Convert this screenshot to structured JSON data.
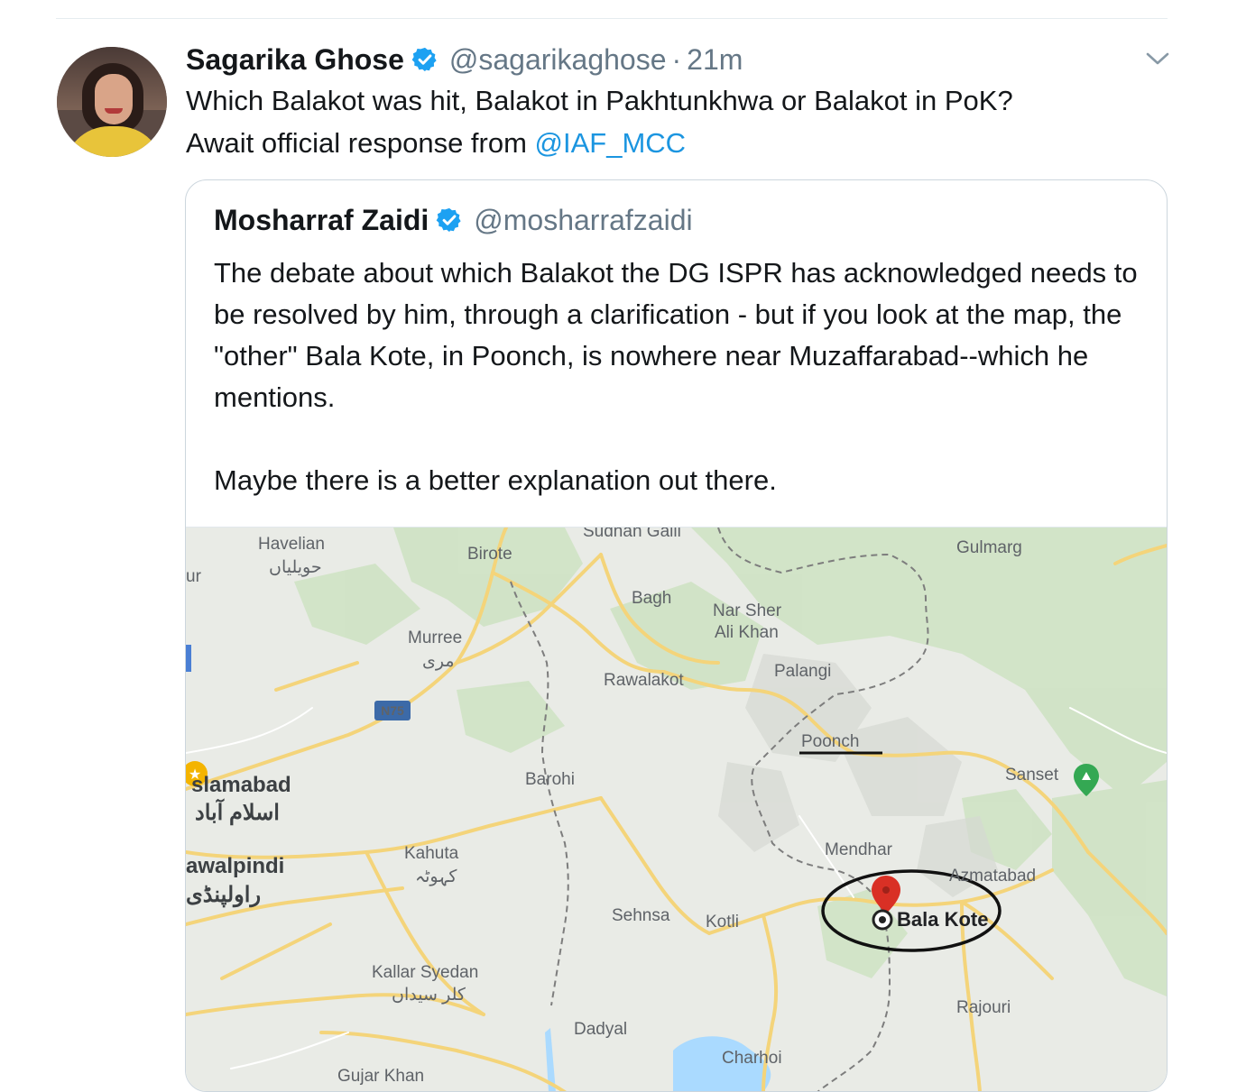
{
  "tweet": {
    "author_name": "Sagarika Ghose",
    "handle": "@sagarikaghose",
    "separator": "·",
    "time": "21m",
    "text_line1": "Which Balakot was hit, Balakot in Pakhtunkhwa or Balakot in PoK?",
    "text_line2_prefix": "Await official response from ",
    "mention": "@IAF_MCC"
  },
  "quoted": {
    "author_name": "Mosharraf Zaidi",
    "handle": "@mosharrafzaidi",
    "para1": "The debate about which Balakot the DG ISPR has acknowledged needs to be resolved by him, through a clarification - but if you look at the map, the \"other\" Bala Kote, in Poonch, is nowhere near Muzaffarabad--which he mentions.",
    "para2": "Maybe there is a better explanation out there."
  },
  "map": {
    "labels": {
      "sudhan_gali": "Sudhan Galli",
      "havelian": "Havelian",
      "havelian_urdu": "حویلیاں",
      "birote": "Birote",
      "gulmarg": "Gulmarg",
      "ur": "ur",
      "bagh": "Bagh",
      "nar_sher_ali_khan_1": "Nar Sher",
      "nar_sher_ali_khan_2": "Ali Khan",
      "murree": "Murree",
      "murree_urdu": "مری",
      "rawalakot": "Rawalakot",
      "palangi": "Palangi",
      "n75": "N75",
      "poonch": "Poonch",
      "islamabad": "slamabad",
      "islamabad_urdu": "اسلام آباد",
      "barohi": "Barohi",
      "sanset": "Sanset",
      "mendhar": "Mendhar",
      "kahuta": "Kahuta",
      "kahuta_urdu": "کہوٹہ",
      "rawalpindi": "awalpindi",
      "rawalpindi_urdu": "راولپنڈی",
      "azmatabad": "Azmatabad",
      "bala_kote": "Bala Kote",
      "sehnsa": "Sehnsa",
      "kotli": "Kotli",
      "kallar_syedan": "Kallar Syedan",
      "kallar_syedan_urdu": "کلر سیداں",
      "rajouri": "Rajouri",
      "dadyal": "Dadyal",
      "charhoi": "Charhoi",
      "gujar_khan": "Gujar Khan"
    }
  },
  "icons": {
    "verified": "verified-badge-icon",
    "chevron": "chevron-down-icon",
    "pin": "map-pin-icon"
  },
  "colors": {
    "link": "#1b95e0",
    "verified": "#1da1f2",
    "secondary_text": "#657786",
    "map_pin": "#d93025",
    "map_land": "#e8eae6",
    "map_forest": "#cfe3c4",
    "map_road": "#f4d47a"
  }
}
